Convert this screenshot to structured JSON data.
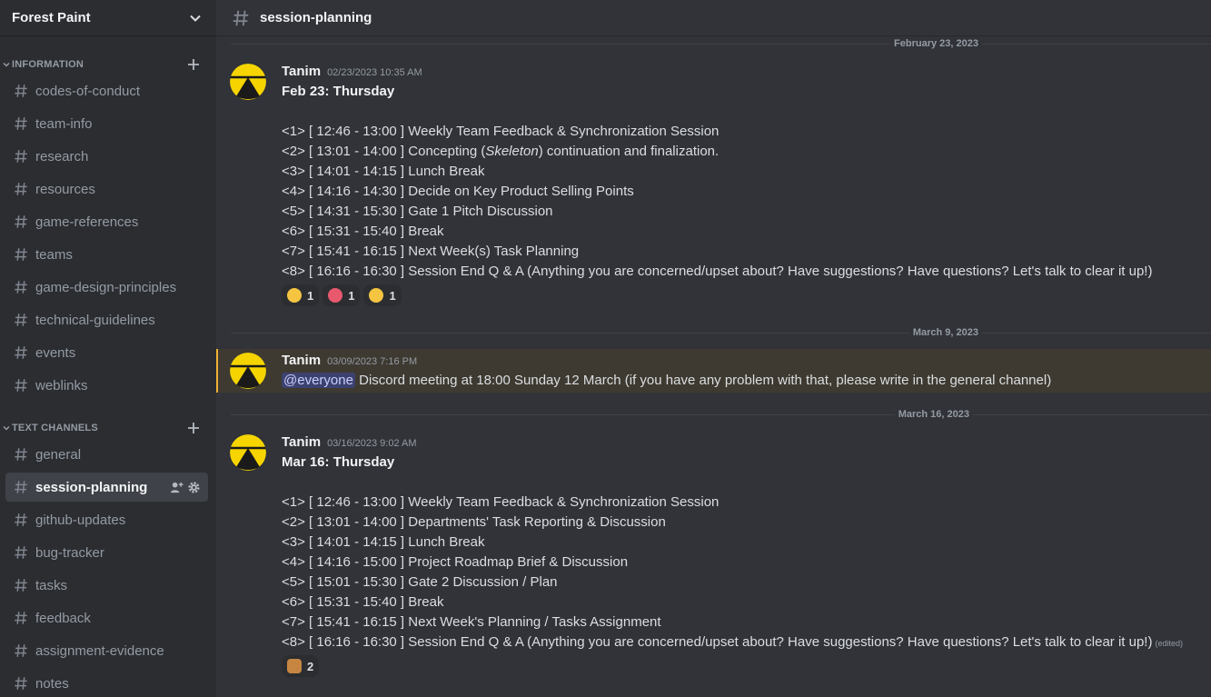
{
  "server": {
    "name": "Forest Paint"
  },
  "categories": [
    {
      "label": "INFORMATION"
    },
    {
      "label": "TEXT CHANNELS"
    }
  ],
  "info_channels": [
    "codes-of-conduct",
    "team-info",
    "research",
    "resources",
    "game-references",
    "teams",
    "game-design-principles",
    "technical-guidelines",
    "events",
    "weblinks"
  ],
  "text_channels": [
    "general",
    "session-planning",
    "github-updates",
    "bug-tracker",
    "tasks",
    "feedback",
    "assignment-evidence",
    "notes"
  ],
  "active_channel": "session-planning",
  "messages": [
    {
      "date_divider": "February 23, 2023",
      "author": "Tanim",
      "timestamp": "02/23/2023 10:35 AM",
      "title": "Feb 23: Thursday",
      "lines": [
        "<1>  [ 12:46 - 13:00 ]   Weekly Team Feedback & Synchronization Session",
        "<3> [ 14:01  -  14:15 ]  Lunch Break",
        "<4> [ 14:16  - 14:30 ]  Decide on Key Product Selling Points",
        "<5> [ 14:31  - 15:30 ]  Gate 1 Pitch Discussion",
        "<6> [ 15:31  - 15:40 ]  Break",
        "<7> [ 15:41  -  16:15 ]  Next Week(s) Task Planning",
        "<8> [ 16:16  - 16:30 ]  Session End Q & A (Anything you are concerned/upset about? Have suggestions? Have questions? Let's talk to clear it up!)"
      ],
      "line2": {
        "pre": "<2> [ 13:01  - 14:00 ]  Concepting (",
        "em": "Skeleton",
        "post": ") continuation and finalization."
      },
      "reactions": [
        {
          "emoji": "thinking-face",
          "count": "1"
        },
        {
          "emoji": "angry-face",
          "count": "1"
        },
        {
          "emoji": "nerd-face",
          "count": "1"
        }
      ]
    },
    {
      "date_divider": "March 9, 2023",
      "author": "Tanim",
      "timestamp": "03/09/2023 7:16 PM",
      "mention": "@everyone",
      "text": " Discord meeting at 18:00 Sunday 12 March (if you have any problem with that, please write in the general channel)"
    },
    {
      "date_divider": "March 16, 2023",
      "author": "Tanim",
      "timestamp": "03/16/2023 9:02 AM",
      "title": "Mar 16: Thursday",
      "lines": [
        "<1>  [ 12:46 - 13:00 ]   Weekly Team Feedback & Synchronization Session",
        "<2> [ 13:01  - 14:00 ]  Departments' Task Reporting & Discussion",
        "<3> [ 14:01  -  14:15 ]  Lunch Break",
        "<4> [ 14:16  - 15:00 ]  Project Roadmap Brief & Discussion",
        "<5> [ 15:01  - 15:30 ]  Gate 2 Discussion / Plan",
        "<6> [ 15:31  - 15:40 ]  Break",
        "<7> [ 15:41  -  16:15 ]  Next Week's Planning / Tasks Assignment",
        "<8> [ 16:16  - 16:30 ]  Session End Q & A (Anything you are concerned/upset about? Have suggestions? Have questions? Let's talk to clear it up!)"
      ],
      "edited_label": "(edited)",
      "reactions": [
        {
          "emoji": "thumbs-up",
          "count": "2"
        }
      ]
    }
  ],
  "colors": {
    "sidebar_bg": "#2b2d31",
    "main_bg": "#313338",
    "mention_bg": "#3e3a31",
    "mention_bar": "#f0b232",
    "avatar_yellow": "#f5d400"
  }
}
